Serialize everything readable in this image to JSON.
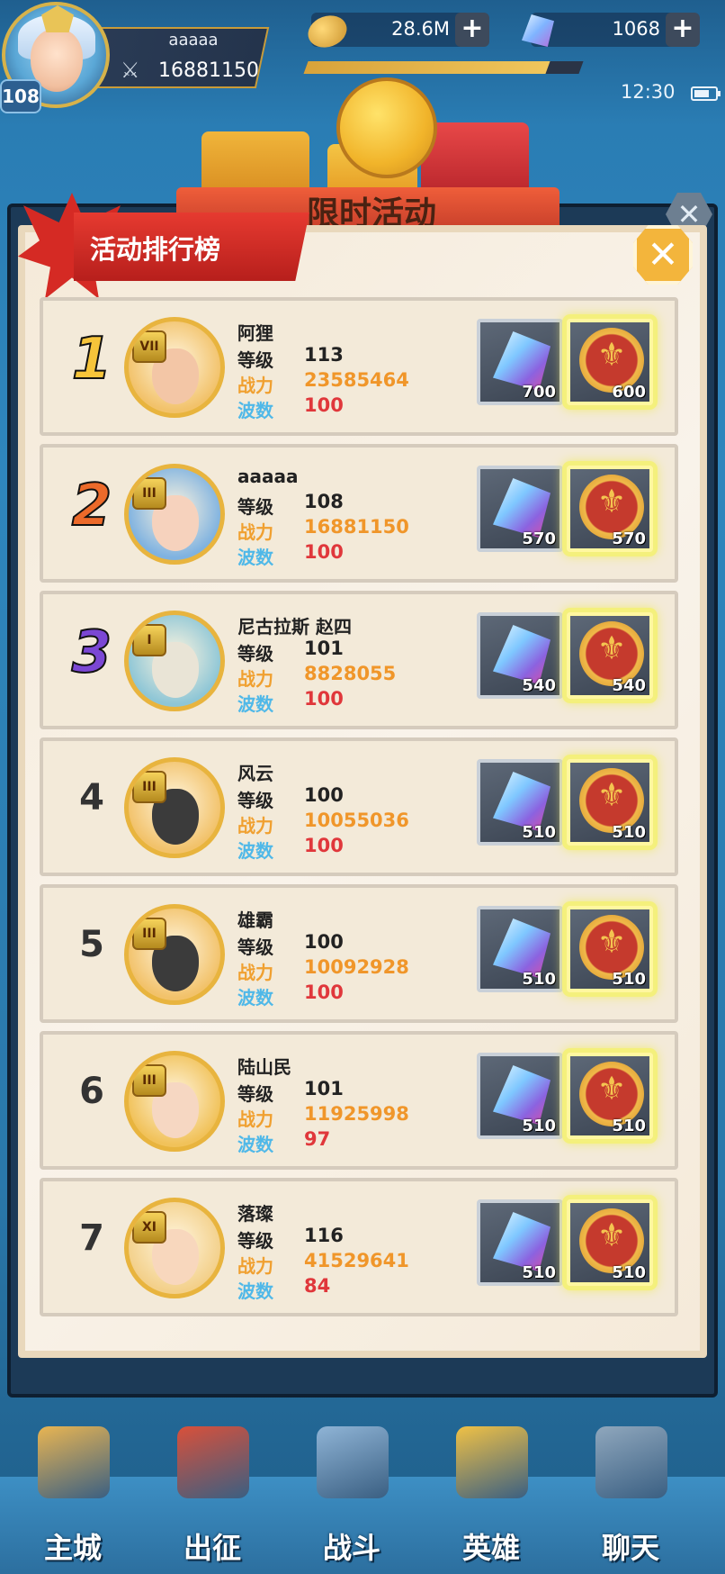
{
  "hud": {
    "player_level": "108",
    "player_name": "aaaaa",
    "player_power": "16881150",
    "gold": "28.6M",
    "gems": "1068",
    "plus": "+",
    "time": "12:30",
    "exp_progress": 0.88
  },
  "panel": {
    "title": "限时活动",
    "tab_label": "活动排行榜",
    "close_glyph": "✕"
  },
  "labels": {
    "level": "等级",
    "power": "战力",
    "wave": "波数"
  },
  "rankings": [
    {
      "rank": "1",
      "vip": "VII",
      "name": "阿狸",
      "level": "113",
      "power": "23585464",
      "wave": "100",
      "gem_reward": "700",
      "medal_reward": "600"
    },
    {
      "rank": "2",
      "vip": "III",
      "name": "aaaaa",
      "level": "108",
      "power": "16881150",
      "wave": "100",
      "gem_reward": "570",
      "medal_reward": "570"
    },
    {
      "rank": "3",
      "vip": "I",
      "name": "尼古拉斯 赵四",
      "level": "101",
      "power": "8828055",
      "wave": "100",
      "gem_reward": "540",
      "medal_reward": "540"
    },
    {
      "rank": "4",
      "vip": "III",
      "name": "风云",
      "level": "100",
      "power": "10055036",
      "wave": "100",
      "gem_reward": "510",
      "medal_reward": "510"
    },
    {
      "rank": "5",
      "vip": "III",
      "name": "雄霸",
      "level": "100",
      "power": "10092928",
      "wave": "100",
      "gem_reward": "510",
      "medal_reward": "510"
    },
    {
      "rank": "6",
      "vip": "III",
      "name": "陆山民",
      "level": "101",
      "power": "11925998",
      "wave": "97",
      "gem_reward": "510",
      "medal_reward": "510"
    },
    {
      "rank": "7",
      "vip": "XI",
      "name": "落璨",
      "level": "116",
      "power": "41529641",
      "wave": "84",
      "gem_reward": "510",
      "medal_reward": "510"
    }
  ],
  "nav": [
    {
      "label": "主城",
      "icon": "city-book-icon"
    },
    {
      "label": "出征",
      "icon": "expedition-ship-icon"
    },
    {
      "label": "战斗",
      "icon": "crossed-swords-icon"
    },
    {
      "label": "英雄",
      "icon": "hero-knight-icon"
    },
    {
      "label": "聊天",
      "icon": "chat-pin-icon"
    }
  ],
  "colors": {
    "background": "#2a78aa",
    "panel_bg": "#f6eee1",
    "tab_red": "#d52a24",
    "power_orange": "#f0962a",
    "wave_red": "#e0373b",
    "wave_label_blue": "#4fb8e8",
    "rank1": "#f6c43a",
    "rank2": "#ec6a2a",
    "rank3": "#7b47d4"
  }
}
